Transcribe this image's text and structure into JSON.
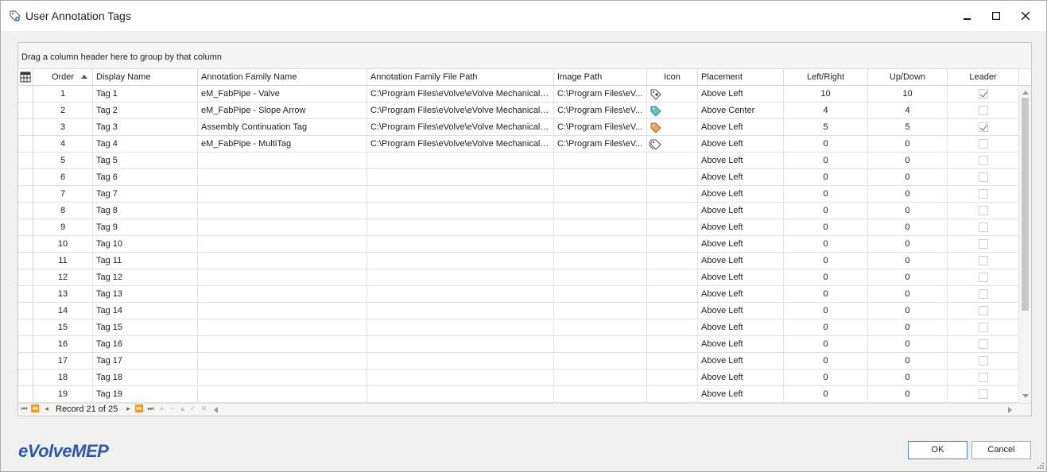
{
  "window": {
    "title": "User Annotation Tags",
    "icon": "tag-settings-icon"
  },
  "grid": {
    "group_panel_text": "Drag a column header here to group by that column",
    "columns": {
      "order": "Order",
      "display_name": "Display Name",
      "annotation_family_name": "Annotation Family Name",
      "annotation_family_file_path": "Annotation Family File Path",
      "image_path": "Image Path",
      "icon": "Icon",
      "placement": "Placement",
      "left_right": "Left/Right",
      "up_down": "Up/Down",
      "leader": "Leader"
    },
    "sort_column": "order",
    "rows": [
      {
        "order": "1",
        "display_name": "Tag 1",
        "family": "eM_FabPipe - Valve",
        "file_path": "C:\\Program Files\\eVolve\\eVolve Mechanical f...",
        "image_path": "C:\\Program Files\\eV...",
        "icon": "valve-tag-icon",
        "placement": "Above Left",
        "left_right": "10",
        "up_down": "10",
        "leader": true
      },
      {
        "order": "2",
        "display_name": "Tag 2",
        "family": "eM_FabPipe - Slope Arrow",
        "file_path": "C:\\Program Files\\eVolve\\eVolve Mechanical f...",
        "image_path": "C:\\Program Files\\eV...",
        "icon": "teal-tag-icon",
        "placement": "Above Center",
        "left_right": "4",
        "up_down": "4",
        "leader": false
      },
      {
        "order": "3",
        "display_name": "Tag 3",
        "family": "Assembly Continuation Tag",
        "file_path": "C:\\Program Files\\eVolve\\eVolve Mechanical f...",
        "image_path": "C:\\Program Files\\eV...",
        "icon": "orange-tag-icon",
        "placement": "Above Left",
        "left_right": "5",
        "up_down": "5",
        "leader": true
      },
      {
        "order": "4",
        "display_name": "Tag 4",
        "family": "eM_FabPipe - MultiTag",
        "file_path": "C:\\Program Files\\eVolve\\eVolve Mechanical f...",
        "image_path": "C:\\Program Files\\eV...",
        "icon": "multi-tag-icon",
        "placement": "Above Left",
        "left_right": "0",
        "up_down": "0",
        "leader": false
      },
      {
        "order": "5",
        "display_name": "Tag 5",
        "family": "",
        "file_path": "",
        "image_path": "",
        "icon": "",
        "placement": "Above Left",
        "left_right": "0",
        "up_down": "0",
        "leader": false
      },
      {
        "order": "6",
        "display_name": "Tag 6",
        "family": "",
        "file_path": "",
        "image_path": "",
        "icon": "",
        "placement": "Above Left",
        "left_right": "0",
        "up_down": "0",
        "leader": false
      },
      {
        "order": "7",
        "display_name": "Tag 7",
        "family": "",
        "file_path": "",
        "image_path": "",
        "icon": "",
        "placement": "Above Left",
        "left_right": "0",
        "up_down": "0",
        "leader": false
      },
      {
        "order": "8",
        "display_name": "Tag 8",
        "family": "",
        "file_path": "",
        "image_path": "",
        "icon": "",
        "placement": "Above Left",
        "left_right": "0",
        "up_down": "0",
        "leader": false
      },
      {
        "order": "9",
        "display_name": "Tag 9",
        "family": "",
        "file_path": "",
        "image_path": "",
        "icon": "",
        "placement": "Above Left",
        "left_right": "0",
        "up_down": "0",
        "leader": false
      },
      {
        "order": "10",
        "display_name": "Tag 10",
        "family": "",
        "file_path": "",
        "image_path": "",
        "icon": "",
        "placement": "Above Left",
        "left_right": "0",
        "up_down": "0",
        "leader": false
      },
      {
        "order": "11",
        "display_name": "Tag 11",
        "family": "",
        "file_path": "",
        "image_path": "",
        "icon": "",
        "placement": "Above Left",
        "left_right": "0",
        "up_down": "0",
        "leader": false
      },
      {
        "order": "12",
        "display_name": "Tag 12",
        "family": "",
        "file_path": "",
        "image_path": "",
        "icon": "",
        "placement": "Above Left",
        "left_right": "0",
        "up_down": "0",
        "leader": false
      },
      {
        "order": "13",
        "display_name": "Tag 13",
        "family": "",
        "file_path": "",
        "image_path": "",
        "icon": "",
        "placement": "Above Left",
        "left_right": "0",
        "up_down": "0",
        "leader": false
      },
      {
        "order": "14",
        "display_name": "Tag 14",
        "family": "",
        "file_path": "",
        "image_path": "",
        "icon": "",
        "placement": "Above Left",
        "left_right": "0",
        "up_down": "0",
        "leader": false
      },
      {
        "order": "15",
        "display_name": "Tag 15",
        "family": "",
        "file_path": "",
        "image_path": "",
        "icon": "",
        "placement": "Above Left",
        "left_right": "0",
        "up_down": "0",
        "leader": false
      },
      {
        "order": "16",
        "display_name": "Tag 16",
        "family": "",
        "file_path": "",
        "image_path": "",
        "icon": "",
        "placement": "Above Left",
        "left_right": "0",
        "up_down": "0",
        "leader": false
      },
      {
        "order": "17",
        "display_name": "Tag 17",
        "family": "",
        "file_path": "",
        "image_path": "",
        "icon": "",
        "placement": "Above Left",
        "left_right": "0",
        "up_down": "0",
        "leader": false
      },
      {
        "order": "18",
        "display_name": "Tag 18",
        "family": "",
        "file_path": "",
        "image_path": "",
        "icon": "",
        "placement": "Above Left",
        "left_right": "0",
        "up_down": "0",
        "leader": false
      },
      {
        "order": "19",
        "display_name": "Tag 19",
        "family": "",
        "file_path": "",
        "image_path": "",
        "icon": "",
        "placement": "Above Left",
        "left_right": "0",
        "up_down": "0",
        "leader": false
      }
    ],
    "navigator": {
      "record_text": "Record 21 of 25"
    }
  },
  "brand": {
    "logo_text": "eVolveMEP",
    "color": "#2f58a8"
  },
  "buttons": {
    "ok": "OK",
    "cancel": "Cancel"
  },
  "colors": {
    "grid_line": "#e2e2e2",
    "window_bg": "#f0f0f0",
    "ok_border": "#5a7fc0"
  }
}
